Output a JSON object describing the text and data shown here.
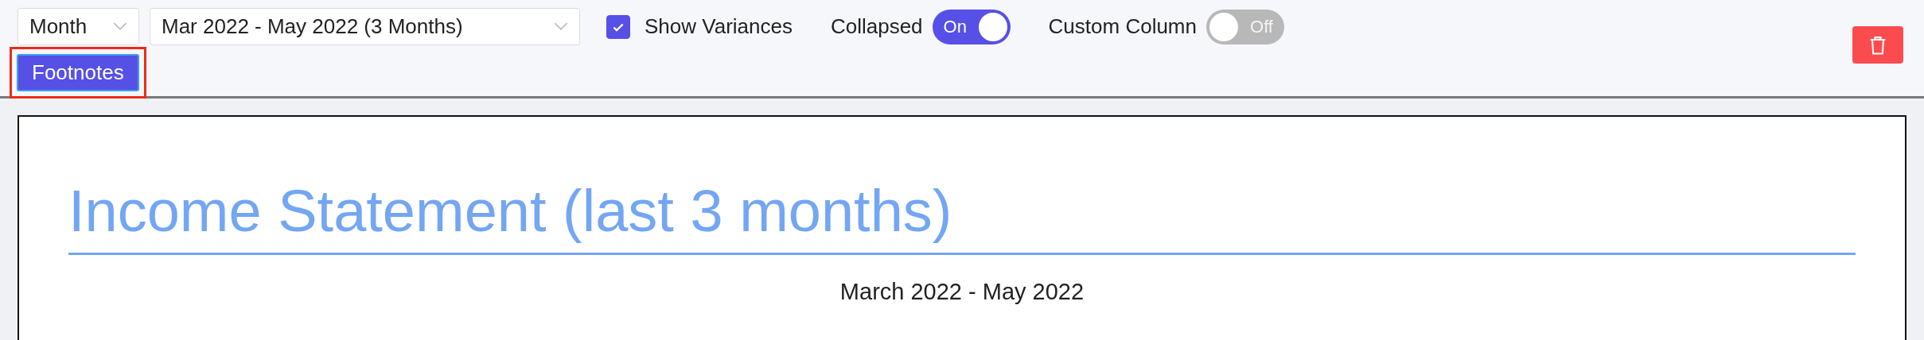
{
  "toolbar": {
    "period_select": {
      "value": "Month"
    },
    "range_select": {
      "value": "Mar 2022 - May 2022 (3 Months)"
    },
    "show_variances": {
      "label": "Show Variances",
      "checked": true
    },
    "toggles": [
      {
        "label": "Collapsed",
        "on": true,
        "state_text": "On"
      },
      {
        "label": "Custom Column",
        "on": false,
        "state_text": "Off"
      }
    ],
    "footnotes_button": {
      "label": "Footnotes",
      "highlighted": true
    }
  },
  "report": {
    "title": "Income Statement (last 3 months)",
    "subtitle": "March 2022 - May 2022"
  }
}
